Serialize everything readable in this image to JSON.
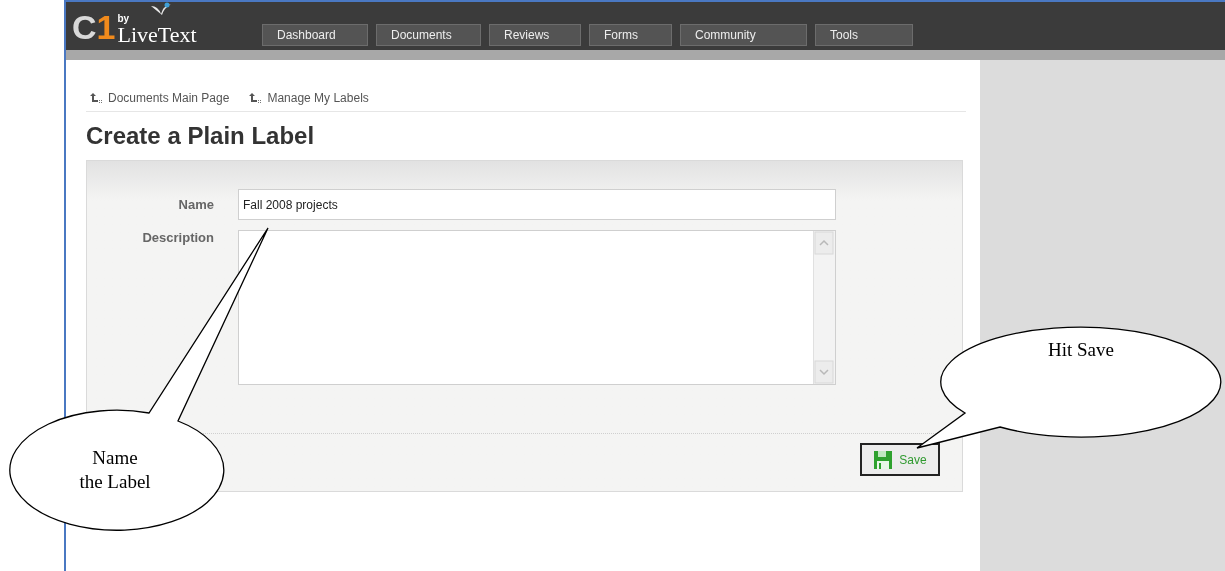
{
  "logo": {
    "by": "by",
    "mark": "C",
    "mark_accent": "1",
    "name": "LiveText"
  },
  "nav_tabs": [
    {
      "label": "Dashboard"
    },
    {
      "label": "Documents"
    },
    {
      "label": "Reviews"
    },
    {
      "label": "Forms"
    },
    {
      "label": "Community"
    },
    {
      "label": "Tools"
    }
  ],
  "breadcrumbs": [
    {
      "label": "Documents Main Page"
    },
    {
      "label": "Manage My Labels"
    }
  ],
  "heading": "Create a Plain Label",
  "form": {
    "fields": [
      {
        "kind": "text",
        "label": "Name",
        "value": "Fall 2008 projects"
      },
      {
        "kind": "textarea",
        "label": "Description"
      }
    ],
    "save_button": "Save"
  },
  "callouts": [
    {
      "lines": [
        "Name",
        "the Label"
      ]
    },
    {
      "lines": [
        "Hit Save"
      ]
    }
  ]
}
